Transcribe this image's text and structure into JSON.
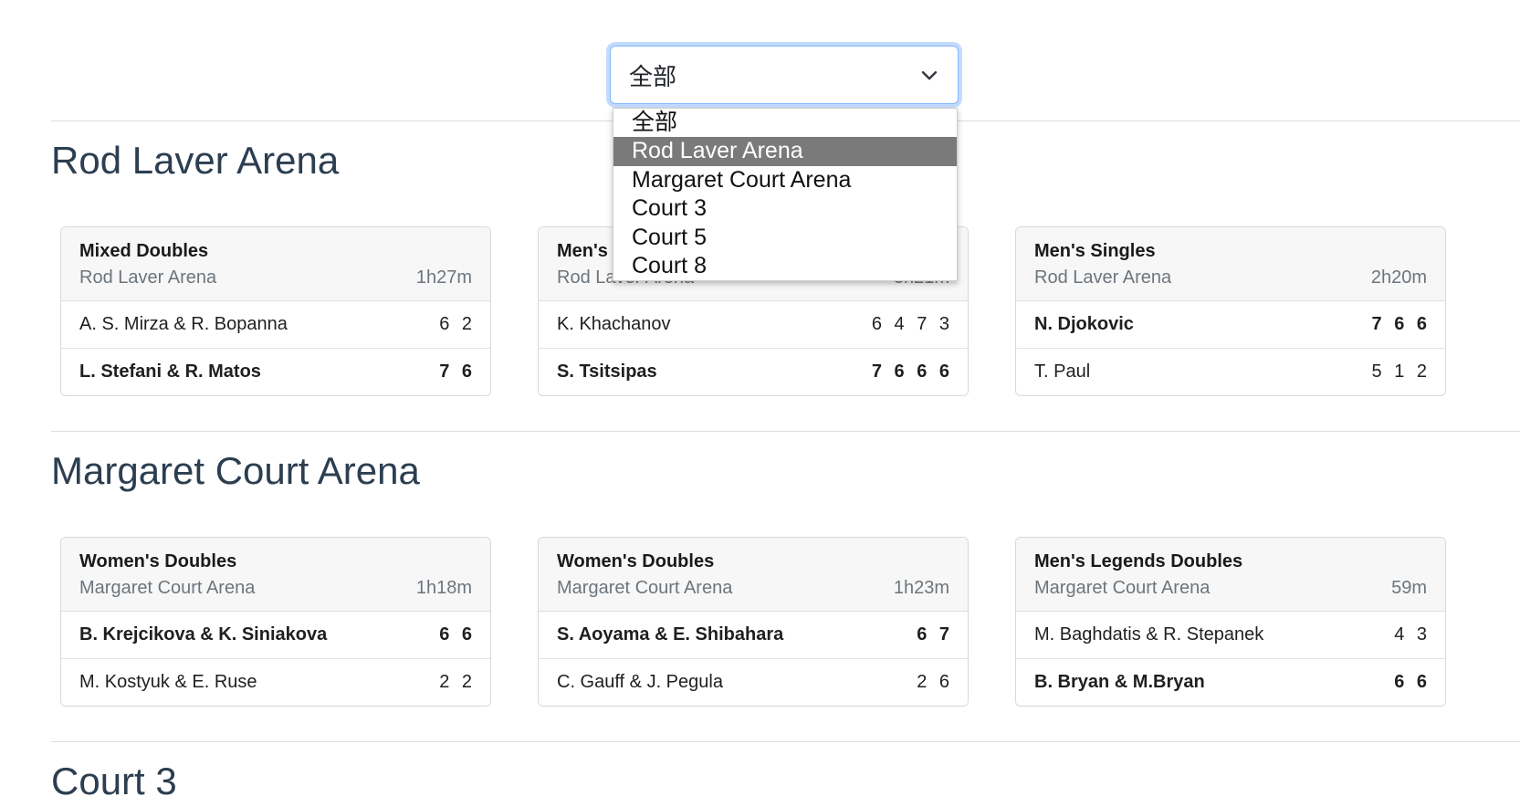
{
  "filter": {
    "selected": "全部",
    "options": [
      "全部",
      "Rod Laver Arena",
      "Margaret Court Arena",
      "Court 3",
      "Court 5",
      "Court 8"
    ],
    "highlighted_index": 1
  },
  "sections": [
    {
      "title": "Rod Laver Arena",
      "matches": [
        {
          "event": "Mixed Doubles",
          "venue": "Rod Laver Arena",
          "duration": "1h27m",
          "teams": [
            {
              "name": "A. S. Mirza & R. Bopanna",
              "score": "6 2",
              "winner": false
            },
            {
              "name": "L. Stefani & R. Matos",
              "score": "7 6",
              "winner": true
            }
          ]
        },
        {
          "event": "Men's",
          "venue": "Rod Laver Arena",
          "duration": "3h2‌1m",
          "teams": [
            {
              "name": "K. Khachanov",
              "score": "6 4 7 3",
              "winner": false
            },
            {
              "name": "S. Tsitsipas",
              "score": "7 6 6 6",
              "winner": true
            }
          ]
        },
        {
          "event": "Men's Singles",
          "venue": "Rod Laver Arena",
          "duration": "2h20m",
          "teams": [
            {
              "name": "N. Djokovic",
              "score": "7 6 6",
              "winner": true
            },
            {
              "name": "T. Paul",
              "score": "5 1 2",
              "winner": false
            }
          ]
        }
      ]
    },
    {
      "title": "Margaret Court Arena",
      "matches": [
        {
          "event": "Women's Doubles",
          "venue": "Margaret Court Arena",
          "duration": "1h18m",
          "teams": [
            {
              "name": "B. Krejcikova & K. Siniakova",
              "score": "6 6",
              "winner": true
            },
            {
              "name": "M. Kostyuk & E. Ruse",
              "score": "2 2",
              "winner": false
            }
          ]
        },
        {
          "event": "Women's Doubles",
          "venue": "Margaret Court Arena",
          "duration": "1h23m",
          "teams": [
            {
              "name": "S. Aoyama & E. Shibahara",
              "score": "6 7",
              "winner": true
            },
            {
              "name": "C. Gauff & J. Pegula",
              "score": "2 6",
              "winner": false
            }
          ]
        },
        {
          "event": "Men's Legends Doubles",
          "venue": "Margaret Court Arena",
          "duration": "59m",
          "teams": [
            {
              "name": "M. Baghdatis & R. Stepanek",
              "score": "4 3",
              "winner": false
            },
            {
              "name": "B. Bryan & M.Bryan",
              "score": "6 6",
              "winner": true
            }
          ]
        }
      ]
    },
    {
      "title": "Court 3",
      "matches": []
    }
  ]
}
